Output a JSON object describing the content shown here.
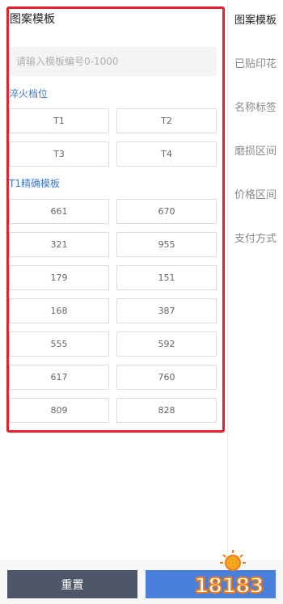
{
  "main": {
    "title": "图案模板",
    "search": {
      "placeholder": "请输入模板编号0-1000"
    },
    "quench": {
      "heading": "淬火档位",
      "items": [
        "T1",
        "T2",
        "T3",
        "T4"
      ]
    },
    "t1": {
      "heading": "T1精确模板",
      "items": [
        "661",
        "670",
        "321",
        "955",
        "179",
        "151",
        "168",
        "387",
        "555",
        "592",
        "617",
        "760",
        "809",
        "828"
      ]
    }
  },
  "sidebar": {
    "items": [
      "图案模板",
      "已贴印花",
      "名称标签",
      "磨损区间",
      "价格区间",
      "支付方式"
    ]
  },
  "footer": {
    "reset_label": "重置",
    "watermark": "18183"
  },
  "colors": {
    "accent": "#3d78c7",
    "highlight": "#e8202a",
    "reset_bg": "#4e5669",
    "confirm_bg": "#4a7fdc"
  }
}
